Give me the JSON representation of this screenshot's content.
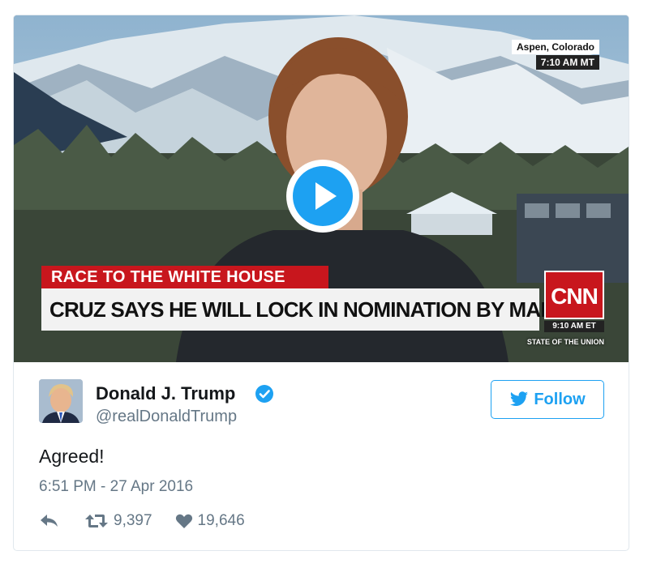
{
  "video": {
    "location": "Aspen, Colorado",
    "local_time": "7:10 AM MT",
    "chyron_kicker": "RACE TO THE WHITE HOUSE",
    "chyron_headline": "CRUZ SAYS HE WILL LOCK IN NOMINATION BY MARCH",
    "network": "CNN",
    "network_time": "9:10 AM ET",
    "show_name": "STATE OF THE UNION",
    "play_icon": "play-icon"
  },
  "tweet": {
    "display_name": "Donald J. Trump",
    "handle": "@realDonaldTrump",
    "verified_icon": "verified-badge-icon",
    "follow_label": "Follow",
    "text": "Agreed!",
    "timestamp": "6:51 PM - 27 Apr 2016",
    "retweets": "9,397",
    "likes": "19,646"
  },
  "colors": {
    "accent": "#1da1f2",
    "cnn_red": "#c8161d",
    "muted_text": "#657786",
    "border": "#e1e8ed"
  }
}
